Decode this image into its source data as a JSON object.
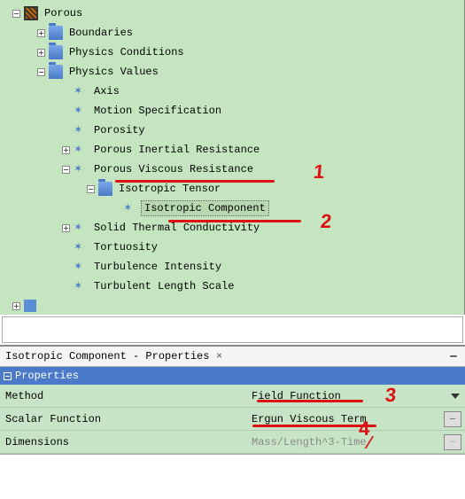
{
  "tree": {
    "root": "Porous",
    "boundaries": "Boundaries",
    "physics_conditions": "Physics Conditions",
    "physics_values": "Physics Values",
    "axis": "Axis",
    "motion_spec": "Motion Specification",
    "porosity": "Porosity",
    "porous_inertial": "Porous Inertial Resistance",
    "porous_viscous": "Porous Viscous Resistance",
    "isotropic_tensor": "Isotropic Tensor",
    "isotropic_component": "Isotropic Component",
    "solid_thermal": "Solid Thermal Conductivity",
    "tortuosity": "Tortuosity",
    "turb_intensity": "Turbulence Intensity",
    "turb_length": "Turbulent Length Scale"
  },
  "properties": {
    "title": "Isotropic Component - Properties",
    "group": "Properties",
    "rows": {
      "method_key": "Method",
      "method_val": "Field Function",
      "scalar_key": "Scalar Function",
      "scalar_val": "Ergun Viscous Term",
      "dim_key": "Dimensions",
      "dim_val": "Mass/Length^3-Time"
    }
  },
  "annotations": {
    "n1": "1",
    "n2": "2",
    "n3": "3",
    "n4": "4"
  }
}
